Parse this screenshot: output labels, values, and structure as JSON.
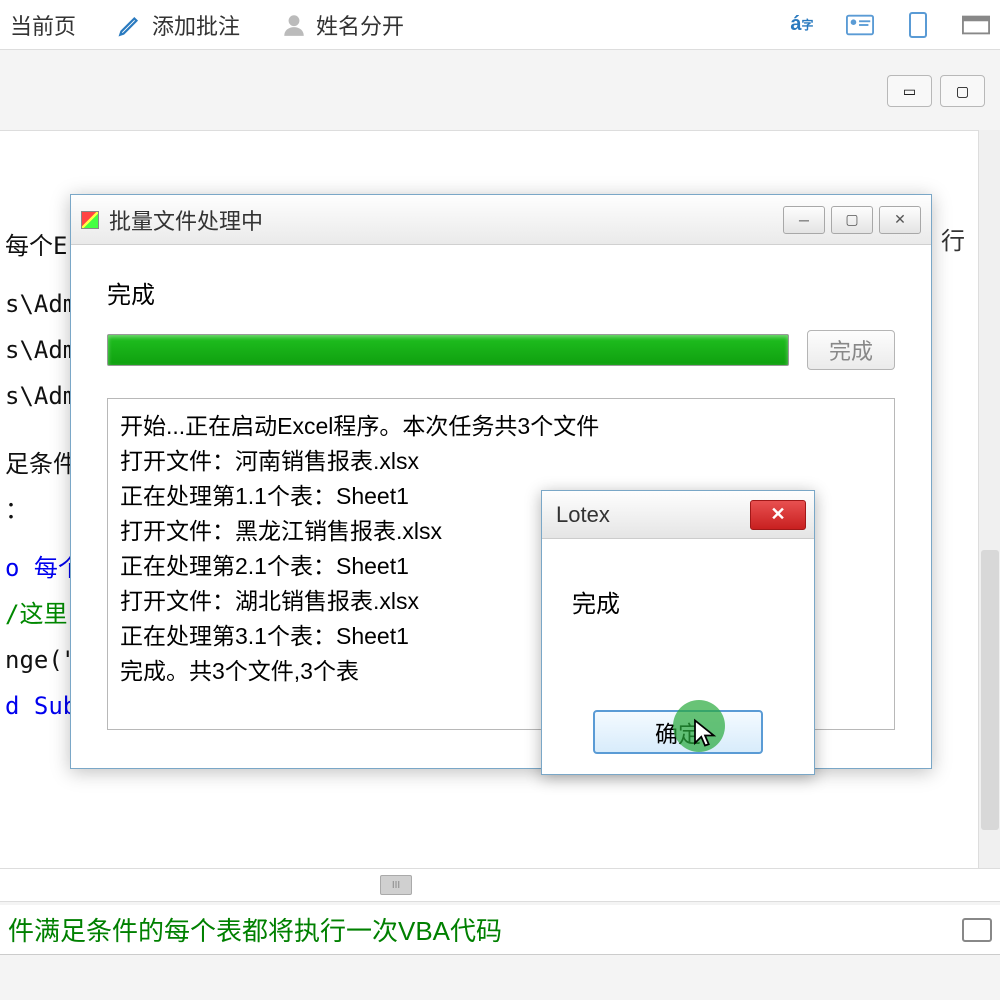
{
  "toolbar": {
    "prev_page": "当前页",
    "add_annotation": "添加批注",
    "split_name": "姓名分开"
  },
  "code": {
    "line1": "每个E",
    "line2": "s\\Adm",
    "line3": "s\\Adm",
    "line4": "s\\Adm",
    "line5_a": "足条件",
    "line5_b": "：",
    "line6": "o 每个",
    "line7": "/这里",
    "line8": "nge(\"",
    "line9": "d Sub",
    "right_snip": "行"
  },
  "dialog": {
    "title": "批量文件处理中",
    "status": "完成",
    "done_btn": "完成",
    "log": [
      "开始...正在启动Excel程序。本次任务共3个文件",
      "打开文件：河南销售报表.xlsx",
      "正在处理第1.1个表：Sheet1",
      "打开文件：黑龙江销售报表.xlsx",
      "正在处理第2.1个表：Sheet1",
      "打开文件：湖北销售报表.xlsx",
      "正在处理第3.1个表：Sheet1",
      "完成。共3个文件,3个表"
    ]
  },
  "lotex": {
    "title": "Lotex",
    "msg": "完成",
    "ok": "确定"
  },
  "bottom": {
    "status": "件满足条件的每个表都将执行一次VBA代码"
  }
}
